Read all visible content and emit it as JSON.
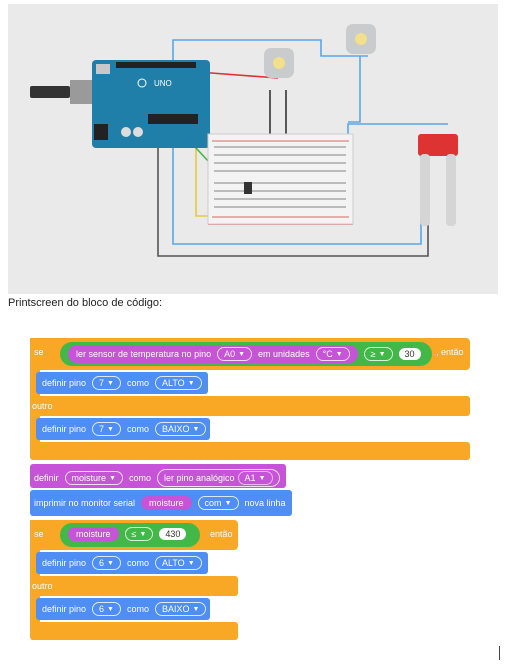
{
  "caption": "Printscreen do bloco de código:",
  "arduino": {
    "logo": "UNO"
  },
  "blocks": {
    "if1": {
      "se": "se",
      "sensor": "ler sensor de temperatura no pino",
      "pin": "A0",
      "units_label": "em unidades",
      "unit": "°C",
      "op": "≥",
      "value": "30",
      "entao": ", então"
    },
    "set1": {
      "definir": "definir pino",
      "pin": "7",
      "como": "como",
      "state": "ALTO"
    },
    "else1": "outro",
    "set2": {
      "definir": "definir pino",
      "pin": "7",
      "como": "como",
      "state": "BAIXO"
    },
    "setvar": {
      "definir": "definir",
      "var": "moisture",
      "como": "como",
      "read": "ler pino analógico",
      "pin": "A1"
    },
    "print": {
      "label": "imprimir no monitor serial",
      "var": "moisture",
      "mode": "com",
      "newline": "nova linha"
    },
    "if2": {
      "se": "se",
      "var": "moisture",
      "op": "≤",
      "value": "430",
      "entao": "então"
    },
    "set3": {
      "definir": "definir pino",
      "pin": "6",
      "como": "como",
      "state": "ALTO"
    },
    "else2": "outro",
    "set4": {
      "definir": "definir pino",
      "pin": "6",
      "como": "como",
      "state": "BAIXO"
    }
  }
}
